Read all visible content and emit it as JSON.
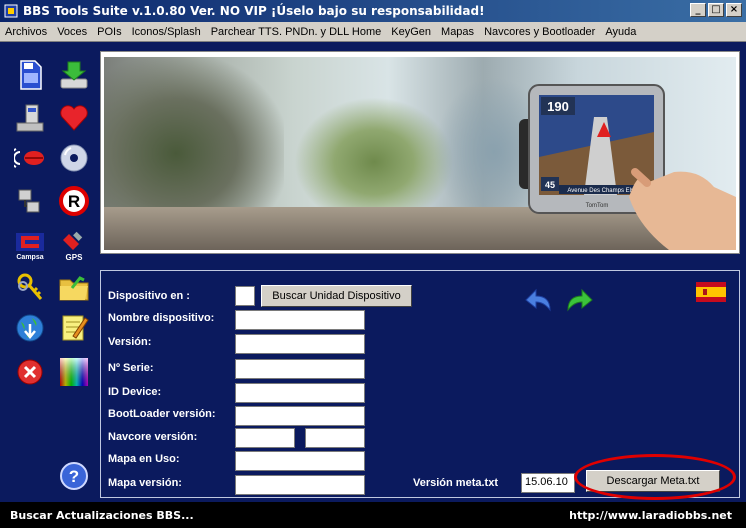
{
  "window": {
    "title": "BBS Tools Suite v.1.0.80  Ver. NO VIP  ¡Úselo bajo su responsabilidad!",
    "minimize": "_",
    "maximize": "□",
    "close": "×"
  },
  "menu": {
    "items": [
      "Archivos",
      "Voces",
      "POIs",
      "Iconos/Splash",
      "Parchear TTS. PNDn. y DLL Home",
      "KeyGen",
      "Mapas",
      "Navcores y Bootloader",
      "Ayuda"
    ]
  },
  "left_icons": {
    "campsa_label": "Campsa",
    "gps_label": "GPS"
  },
  "banner": {
    "gps_screen": {
      "speed": "190",
      "distance": "45",
      "street": "Avenue Des Champs Elysées",
      "brand": "TomTom"
    }
  },
  "form": {
    "device_label": "Dispositivo en :",
    "device_value": "",
    "find_device_button": "Buscar Unidad Dispositivo",
    "device_name_label": "Nombre dispositivo:",
    "device_name_value": "",
    "version_label": "Versión:",
    "version_value": "",
    "serial_label": "Nº Serie:",
    "serial_value": "",
    "id_device_label": "ID Device:",
    "id_device_value": "",
    "bootloader_label": "BootLoader versión:",
    "bootloader_value": "",
    "navcore_label": "Navcore versión:",
    "navcore_value_1": "",
    "navcore_value_2": "",
    "map_in_use_label": "Mapa en Uso:",
    "map_in_use_value": "",
    "map_version_label": "Mapa versión:",
    "map_version_value": "",
    "meta_version_label": "Versión meta.txt",
    "meta_version_value": "15.06.10",
    "download_meta_button": "Descargar Meta.txt"
  },
  "status": {
    "left": "Buscar Actualizaciones BBS...",
    "right": "http://www.laradiobbs.net"
  },
  "colors": {
    "window_bg": "#0b1a5e",
    "highlight_oval": "#e00000"
  }
}
